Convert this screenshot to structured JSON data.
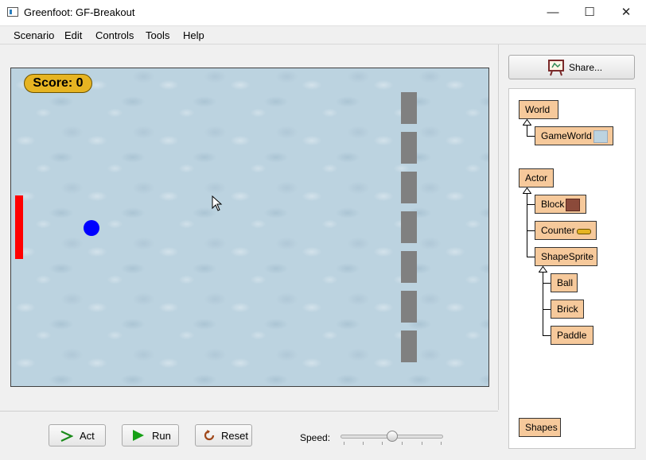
{
  "window": {
    "title": "Greenfoot: GF-Breakout",
    "minimize": "—",
    "maximize": "☐",
    "close": "✕"
  },
  "menu": [
    "Scenario",
    "Edit",
    "Controls",
    "Tools",
    "Help"
  ],
  "world": {
    "score_text": "Score: 0",
    "brick_count": 7
  },
  "controls": {
    "act_label": "Act",
    "run_label": "Run",
    "reset_label": "Reset",
    "speed_label": "Speed:",
    "speed_value": 0.5
  },
  "share": {
    "label": "Share..."
  },
  "classes": {
    "world": "World",
    "gameworld": "GameWorld",
    "actor": "Actor",
    "block": "Block",
    "counter": "Counter",
    "shapesprite": "ShapeSprite",
    "ball": "Ball",
    "brick": "Brick",
    "paddle": "Paddle",
    "shapes": "Shapes"
  },
  "colors": {
    "class_fill": "#f6c99b",
    "paddle": "#ff0000",
    "ball": "#0000ff",
    "brick": "#808080",
    "score_bg": "#e6b422"
  }
}
